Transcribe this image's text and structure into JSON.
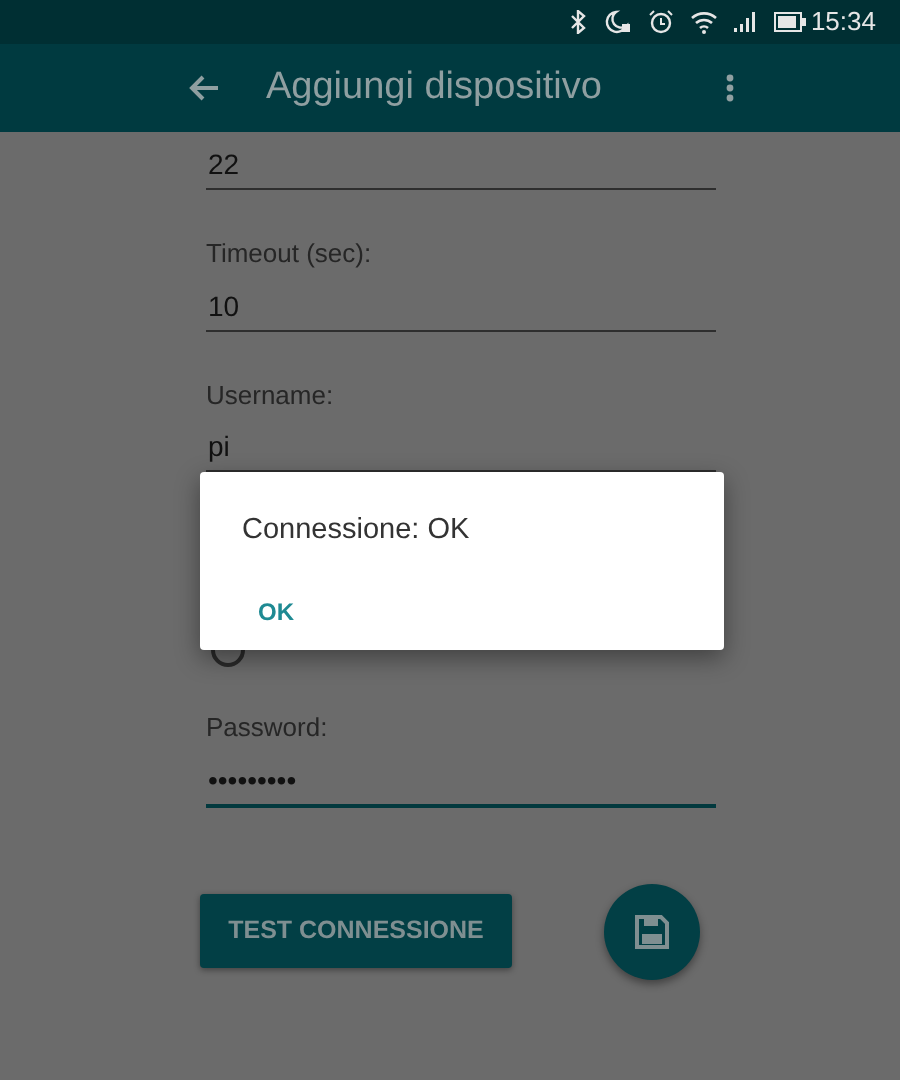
{
  "status_bar": {
    "time": "15:34"
  },
  "app_bar": {
    "title": "Aggiungi dispositivo"
  },
  "fields": [
    {
      "value": "22",
      "focused": false
    },
    {
      "label": "Timeout (sec):",
      "value": "10",
      "focused": false
    },
    {
      "label": "Username:",
      "value": "pi",
      "focused": false
    }
  ],
  "password": {
    "label": "Password:",
    "value": "•••••••••",
    "focused": true
  },
  "buttons": {
    "test": "TEST CONNESSIONE"
  },
  "dialog": {
    "message": "Connessione: OK",
    "action": "OK"
  }
}
